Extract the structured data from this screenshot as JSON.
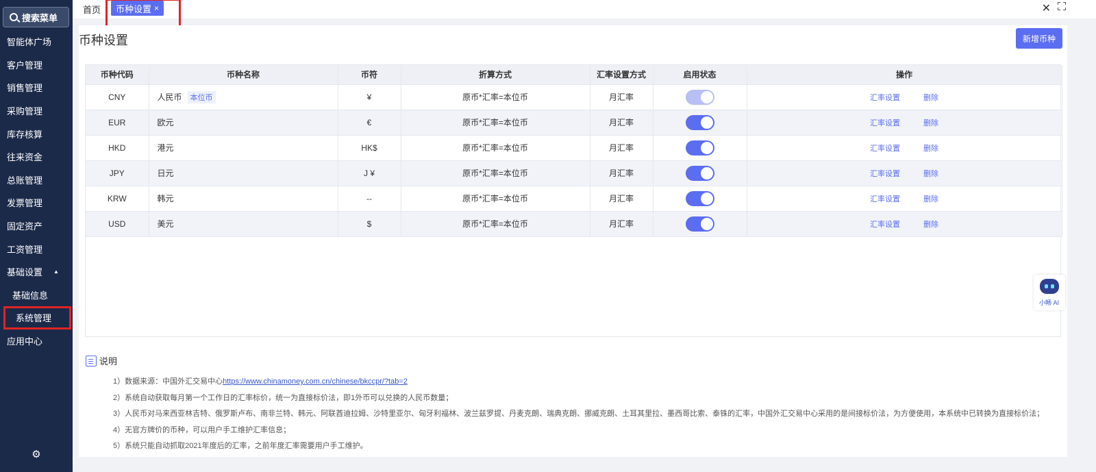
{
  "sidebar": {
    "search_label": "搜索菜单",
    "items": [
      {
        "label": "智能体广场"
      },
      {
        "label": "客户管理"
      },
      {
        "label": "销售管理"
      },
      {
        "label": "采购管理"
      },
      {
        "label": "库存核算"
      },
      {
        "label": "往来资金"
      },
      {
        "label": "总账管理"
      },
      {
        "label": "发票管理"
      },
      {
        "label": "固定资产"
      },
      {
        "label": "工资管理"
      },
      {
        "label": "基础设置"
      },
      {
        "label": "基础信息"
      },
      {
        "label": "系统管理"
      },
      {
        "label": "应用中心"
      }
    ]
  },
  "tabs": {
    "home": "首页",
    "active": "币种设置",
    "active_close": "×"
  },
  "page": {
    "title": "币种设置",
    "add_button": "新增币种"
  },
  "table": {
    "columns": [
      "币种代码",
      "币种名称",
      "币符",
      "折算方式",
      "汇率设置方式",
      "启用状态",
      "操作"
    ],
    "rows": [
      {
        "code": "CNY",
        "name": "人民币",
        "tag": "本位币",
        "symbol": "¥",
        "method": "原币*汇率=本位币",
        "rate_mode": "月汇率",
        "enabled": true,
        "toggle_disabled": true
      },
      {
        "code": "EUR",
        "name": "欧元",
        "tag": "",
        "symbol": "€",
        "method": "原币*汇率=本位币",
        "rate_mode": "月汇率",
        "enabled": true,
        "toggle_disabled": false
      },
      {
        "code": "HKD",
        "name": "港元",
        "tag": "",
        "symbol": "HK$",
        "method": "原币*汇率=本位币",
        "rate_mode": "月汇率",
        "enabled": true,
        "toggle_disabled": false
      },
      {
        "code": "JPY",
        "name": "日元",
        "tag": "",
        "symbol": "J ¥",
        "method": "原币*汇率=本位币",
        "rate_mode": "月汇率",
        "enabled": true,
        "toggle_disabled": false
      },
      {
        "code": "KRW",
        "name": "韩元",
        "tag": "",
        "symbol": "--",
        "method": "原币*汇率=本位币",
        "rate_mode": "月汇率",
        "enabled": true,
        "toggle_disabled": false
      },
      {
        "code": "USD",
        "name": "美元",
        "tag": "",
        "symbol": "$",
        "method": "原币*汇率=本位币",
        "rate_mode": "月汇率",
        "enabled": true,
        "toggle_disabled": false
      }
    ],
    "op_rate": "汇率设置",
    "op_delete": "删除"
  },
  "notes": {
    "title": "说明",
    "n1_prefix": "1）数据来源：中国外汇交易中心",
    "n1_link": "https://www.chinamoney.com.cn/chinese/bkccpr/?tab=2",
    "n2": "2）系统自动获取每月第一个工作日的汇率标价，统一为直接标价法，即1外币可以兑换的人民币数量；",
    "n3": "3）人民币对马来西亚林吉特、俄罗斯卢布、南非兰特、韩元、阿联酋迪拉姆、沙特里亚尔、匈牙利福林、波兰兹罗提、丹麦克朗、瑞典克朗、挪威克朗、土耳其里拉、墨西哥比索、泰铢的汇率，中国外汇交易中心采用的是间接标价法，为方便使用，本系统中已转换为直接标价法；",
    "n4": "4）无官方牌价的币种，可以用户手工维护汇率信息；",
    "n5": "5）系统只能自动抓取2021年度后的汇率，之前年度汇率需要用户手工维护。"
  },
  "ai_widget": {
    "label": "小畅 AI"
  },
  "colors": {
    "sidebar_bg": "#1c2a4a",
    "accent": "#5b6df0",
    "highlight": "#e02424"
  },
  "icons": [
    "search-icon",
    "close-icon",
    "fullscreen-icon",
    "gear-icon",
    "document-icon",
    "caret-up-icon"
  ]
}
